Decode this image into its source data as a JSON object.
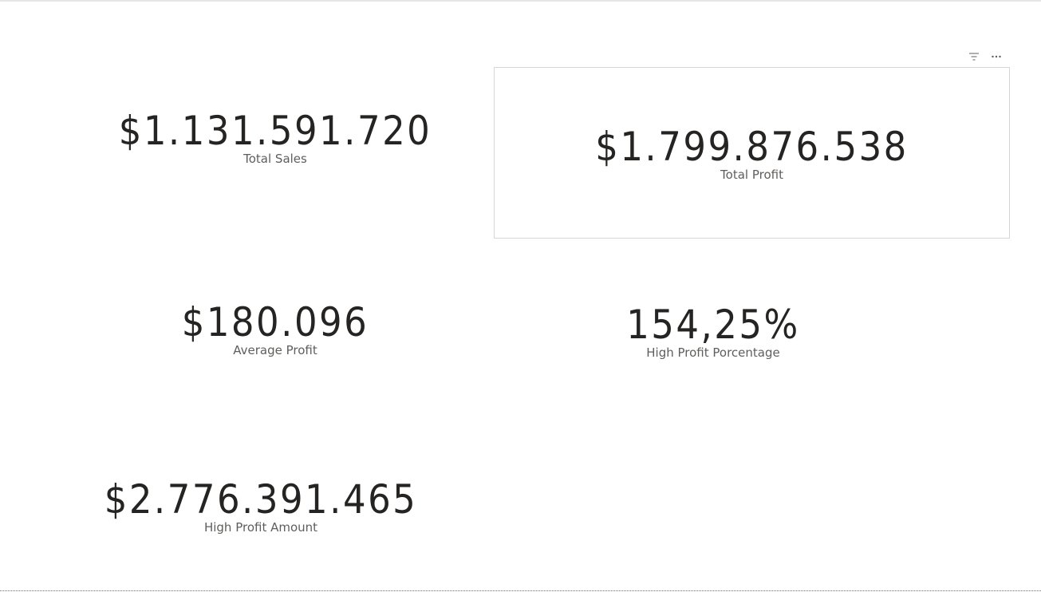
{
  "cards": [
    {
      "value": "$1.131.591.720",
      "label": "Total Sales"
    },
    {
      "value": "$1.799.876.538",
      "label": "Total Profit"
    },
    {
      "value": "$180.096",
      "label": "Average Profit"
    },
    {
      "value": "154,25%",
      "label": "High Profit Porcentage"
    },
    {
      "value": "$2.776.391.465",
      "label": "High Profit Amount"
    }
  ],
  "visual_header": {
    "icons": [
      "filter-icon",
      "more-options-icon"
    ]
  },
  "colors": {
    "value_text": "#252423",
    "label_text": "#605e5c",
    "selected_border": "#d6d6d6"
  }
}
